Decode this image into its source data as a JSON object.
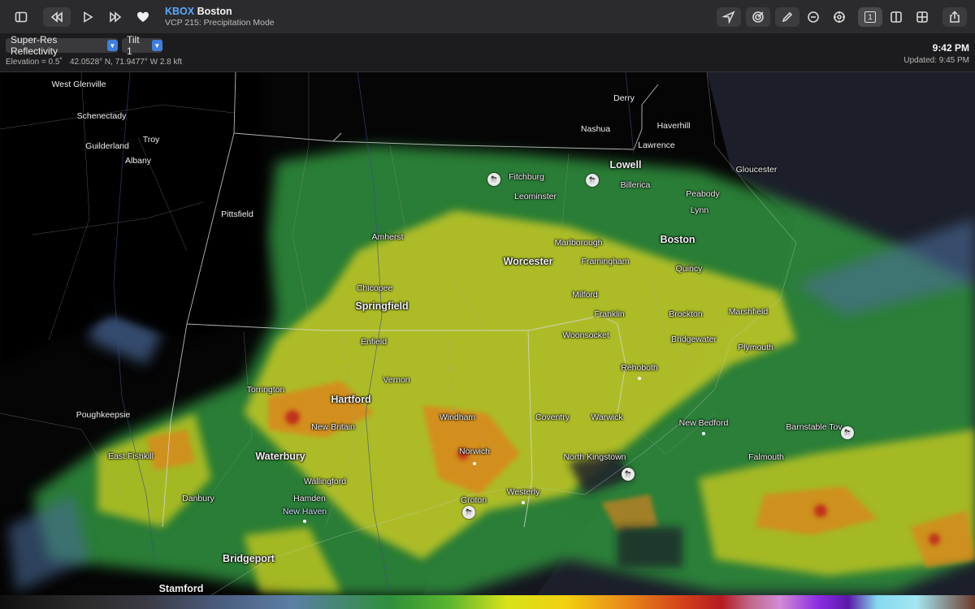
{
  "toolbar": {
    "station_code": "KBOX",
    "station_name": "Boston",
    "subtitle": "VCP 215: Precipitation Mode",
    "icons": [
      "sidebar-icon",
      "rewind-icon",
      "play-icon",
      "fast-forward-icon",
      "heart-icon",
      "location-icon",
      "target-icon",
      "pencil-icon",
      "minus-circle-icon",
      "crosshair-icon",
      "single-pane-icon",
      "split-pane-icon",
      "quad-pane-icon",
      "share-icon"
    ],
    "single_pane_label": "1"
  },
  "subbar": {
    "product": "Super-Res Reflectivity",
    "tilt": "Tilt 1",
    "elevation": "Elevation = 0.5˚",
    "coordinates": "42.0528° N, 71.9477° W 2.8 kft",
    "time": "9:42 PM",
    "updated": "Updated: 9:45 PM"
  },
  "map": {
    "places": [
      {
        "name": "West Glenville"
      },
      {
        "name": "Schenectady"
      },
      {
        "name": "Troy"
      },
      {
        "name": "Guilderland"
      },
      {
        "name": "Albany"
      },
      {
        "name": "Pittsfield"
      },
      {
        "name": "Derry"
      },
      {
        "name": "Nashua"
      },
      {
        "name": "Haverhill"
      },
      {
        "name": "Lawrence"
      },
      {
        "name": "Lowell",
        "major": true
      },
      {
        "name": "Gloucester"
      },
      {
        "name": "Fitchburg"
      },
      {
        "name": "Billerica"
      },
      {
        "name": "Leominster"
      },
      {
        "name": "Peabody"
      },
      {
        "name": "Lynn"
      },
      {
        "name": "Amherst"
      },
      {
        "name": "Marlborough"
      },
      {
        "name": "Boston",
        "major": true
      },
      {
        "name": "Worcester",
        "major": true
      },
      {
        "name": "Framingham"
      },
      {
        "name": "Quincy"
      },
      {
        "name": "Chicopee"
      },
      {
        "name": "Springfield",
        "major": true
      },
      {
        "name": "Milford"
      },
      {
        "name": "Franklin"
      },
      {
        "name": "Brockton"
      },
      {
        "name": "Marshfield"
      },
      {
        "name": "Enfield"
      },
      {
        "name": "Woonsocket"
      },
      {
        "name": "Bridgewater"
      },
      {
        "name": "Plymouth"
      },
      {
        "name": "Rehoboth"
      },
      {
        "name": "Vernon"
      },
      {
        "name": "Torrington"
      },
      {
        "name": "Hartford",
        "major": true
      },
      {
        "name": "Poughkeepsie"
      },
      {
        "name": "Windham"
      },
      {
        "name": "Coventry"
      },
      {
        "name": "Warwick"
      },
      {
        "name": "New Bedford"
      },
      {
        "name": "Barnstable Tov"
      },
      {
        "name": "New Britain"
      },
      {
        "name": "Norwich"
      },
      {
        "name": "East Fishkill"
      },
      {
        "name": "Waterbury",
        "major": true
      },
      {
        "name": "North Kingstown"
      },
      {
        "name": "Falmouth"
      },
      {
        "name": "Wallingford"
      },
      {
        "name": "Danbury"
      },
      {
        "name": "Groton"
      },
      {
        "name": "Westerly"
      },
      {
        "name": "Hamden"
      },
      {
        "name": "New Haven",
        "blue": true
      },
      {
        "name": "Bridgeport",
        "major": true
      },
      {
        "name": "Stamford",
        "major": true
      }
    ]
  },
  "colors": {
    "accent": "#3f7fe0",
    "station_code": "#5aa9ff",
    "toolbar_bg": "#2b2b2d",
    "radar_green": "#2f8f3a",
    "radar_yellow": "#e6d61a",
    "radar_orange": "#e0801c",
    "radar_red": "#c0301c"
  }
}
